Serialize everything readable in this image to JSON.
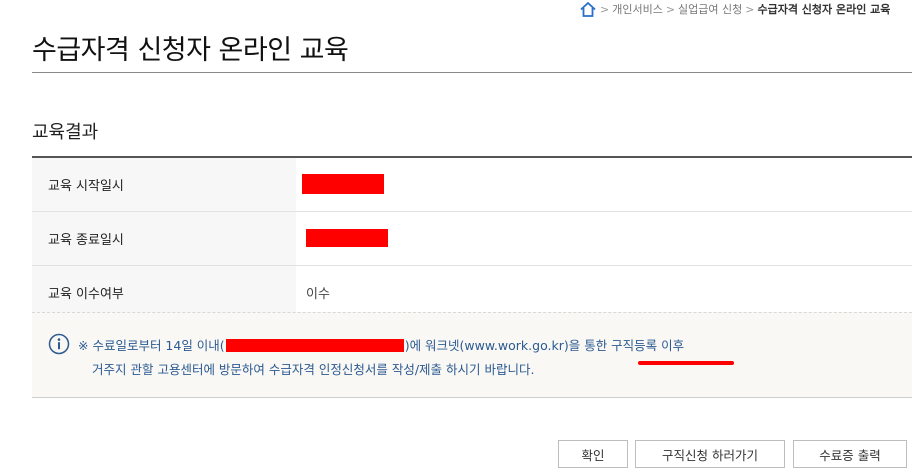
{
  "breadcrumb": {
    "items": [
      "개인서비스",
      "실업급여 신청"
    ],
    "current": "수급자격 신청자 온라인 교육"
  },
  "page": {
    "title": "수급자격 신청자 온라인 교육"
  },
  "result": {
    "section_title": "교육결과",
    "rows": [
      {
        "label": "교육 시작일시",
        "value": ""
      },
      {
        "label": "교육 종료일시",
        "value": ""
      },
      {
        "label": "교육 이수여부",
        "value": "이수"
      }
    ]
  },
  "notice": {
    "line1_prefix": "※ 수료일로부터 14일 이내(",
    "line1_suffix": ")에 워크넷(www.work.go.kr)을 통한 구직등록 이후",
    "line2": "거주지 관할 고용센터에 방문하여 수급자격 인정신청서를 작성/제출 하시기 바랍니다."
  },
  "buttons": {
    "confirm": "확인",
    "job_apply": "구직신청 하러가기",
    "certificate": "수료증 출력"
  },
  "icons": {
    "home": "home-icon",
    "info": "info-icon"
  },
  "colors": {
    "notice_text": "#2c5a91",
    "redaction": "#ff0000"
  }
}
